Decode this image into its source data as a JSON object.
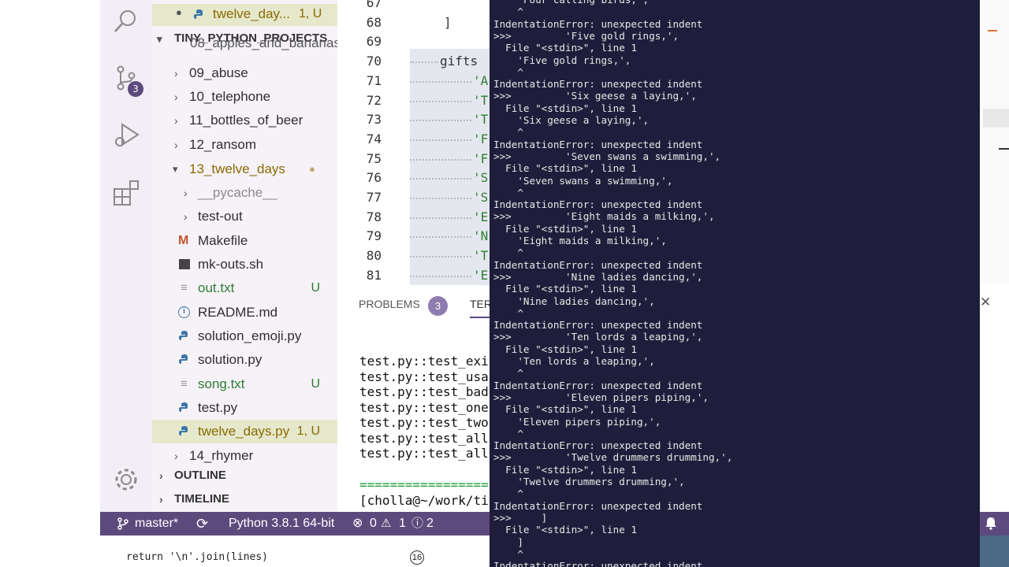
{
  "open_editor_tab": {
    "filename": "twelve_day...",
    "status": "1, U"
  },
  "explorer": {
    "root_label": "TINY_PYTHON_PROJECTS",
    "items": [
      {
        "label": "08_apples_and_bananas"
      },
      {
        "label": "09_abuse"
      },
      {
        "label": "10_telephone"
      },
      {
        "label": "11_bottles_of_beer"
      },
      {
        "label": "12_ransom"
      },
      {
        "label": "13_twelve_days"
      },
      {
        "label": "__pycache__"
      },
      {
        "label": "test-out"
      },
      {
        "label": "Makefile"
      },
      {
        "label": "mk-outs.sh"
      },
      {
        "label": "out.txt",
        "status": "U"
      },
      {
        "label": "README.md"
      },
      {
        "label": "solution_emoji.py"
      },
      {
        "label": "solution.py"
      },
      {
        "label": "song.txt",
        "status": "U"
      },
      {
        "label": "test.py"
      },
      {
        "label": "twelve_days.py",
        "status": "1, U"
      },
      {
        "label": "14_rhymer"
      }
    ],
    "outline_label": "OUTLINE",
    "timeline_label": "TIMELINE"
  },
  "activity": {
    "scm_badge": "3"
  },
  "editor": {
    "line_numbers": [
      "67",
      "68",
      "69",
      "70",
      "71",
      "72",
      "73",
      "74",
      "75",
      "76",
      "77",
      "78",
      "79",
      "80",
      "81"
    ],
    "lines": [
      "",
      "]",
      "",
      "gifts",
      "'A",
      "'T",
      "'T",
      "'F",
      "'F",
      "'S",
      "'S",
      "'E",
      "'N",
      "'T",
      "'E"
    ]
  },
  "panel": {
    "problems_label": "PROBLEMS",
    "problems_count": "3",
    "terminal_tab": "TER",
    "lines": [
      "test.py::test_exi",
      "test.py::test_usa",
      "test.py::test_bad",
      "test.py::test_one",
      "test.py::test_two",
      "test.py::test_all",
      "test.py::test_all",
      "",
      "=================",
      "[cholla@~/work/ti"
    ]
  },
  "statusbar": {
    "branch": "master*",
    "python": "Python 3.8.1 64-bit",
    "errors": "0",
    "warnings": "1",
    "info": "2"
  },
  "background_code": {
    "line": "return '\\n'.join(lines)",
    "marker": "16"
  },
  "terminal": {
    "lines": [
      "    'Four calling birds,',",
      "    ^",
      "IndentationError: unexpected indent",
      ">>>         'Five gold rings,',",
      "  File \"<stdin>\", line 1",
      "    'Five gold rings,',",
      "    ^",
      "IndentationError: unexpected indent",
      ">>>         'Six geese a laying,',",
      "  File \"<stdin>\", line 1",
      "    'Six geese a laying,',",
      "    ^",
      "IndentationError: unexpected indent",
      ">>>         'Seven swans a swimming,',",
      "  File \"<stdin>\", line 1",
      "    'Seven swans a swimming,',",
      "    ^",
      "IndentationError: unexpected indent",
      ">>>         'Eight maids a milking,',",
      "  File \"<stdin>\", line 1",
      "    'Eight maids a milking,',",
      "    ^",
      "IndentationError: unexpected indent",
      ">>>         'Nine ladies dancing,',",
      "  File \"<stdin>\", line 1",
      "    'Nine ladies dancing,',",
      "    ^",
      "IndentationError: unexpected indent",
      ">>>         'Ten lords a leaping,',",
      "  File \"<stdin>\", line 1",
      "    'Ten lords a leaping,',",
      "    ^",
      "IndentationError: unexpected indent",
      ">>>         'Eleven pipers piping,',",
      "  File \"<stdin>\", line 1",
      "    'Eleven pipers piping,',",
      "    ^",
      "IndentationError: unexpected indent",
      ">>>         'Twelve drummers drumming,',",
      "  File \"<stdin>\", line 1",
      "    'Twelve drummers drumming,',",
      "    ^",
      "IndentationError: unexpected indent",
      ">>>     ]",
      "  File \"<stdin>\", line 1",
      "    ]",
      "    ^",
      "IndentationError: unexpected indent"
    ]
  },
  "colors": {
    "accent": "#5c4a7d",
    "terminal_bg": "#1e1e3c",
    "modified": "#8a6a00",
    "untracked": "#2e7d32"
  }
}
